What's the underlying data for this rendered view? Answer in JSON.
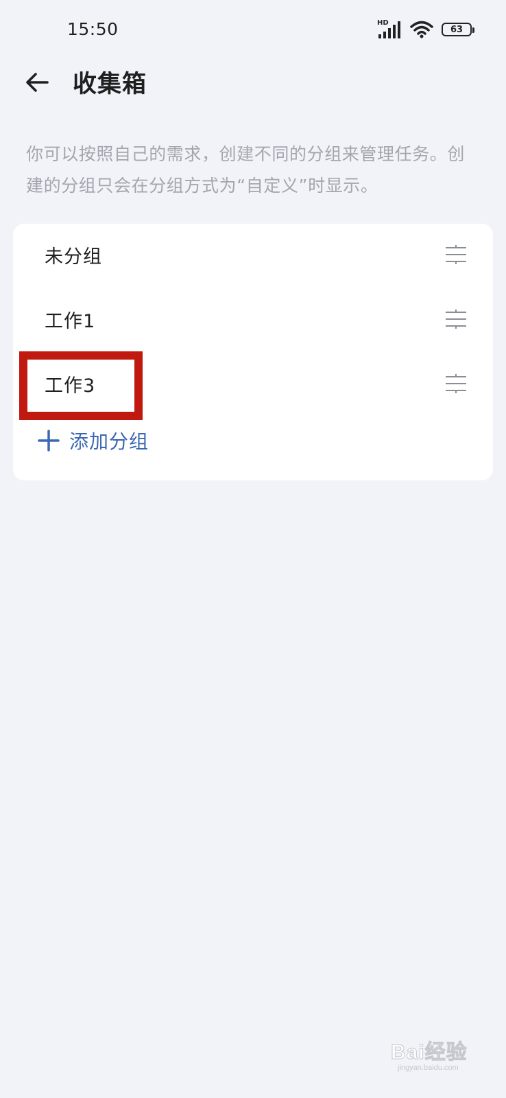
{
  "status_bar": {
    "time": "15:50",
    "signal_badge": "HD",
    "battery_level": "63"
  },
  "header": {
    "title": "收集箱"
  },
  "description": "你可以按照自己的需求，创建不同的分组来管理任务。创建的分组只会在分组方式为“自定义”时显示。",
  "groups": [
    {
      "label": "未分组"
    },
    {
      "label": "工作1"
    },
    {
      "label": "工作3"
    }
  ],
  "add_group_label": "添加分组",
  "watermark": {
    "text": "Bai经验",
    "sub": "jingyan.baidu.com"
  },
  "colors": {
    "background": "#f1f3f8",
    "card": "#ffffff",
    "accent": "#3b67b3",
    "highlight": "#c0190f"
  }
}
